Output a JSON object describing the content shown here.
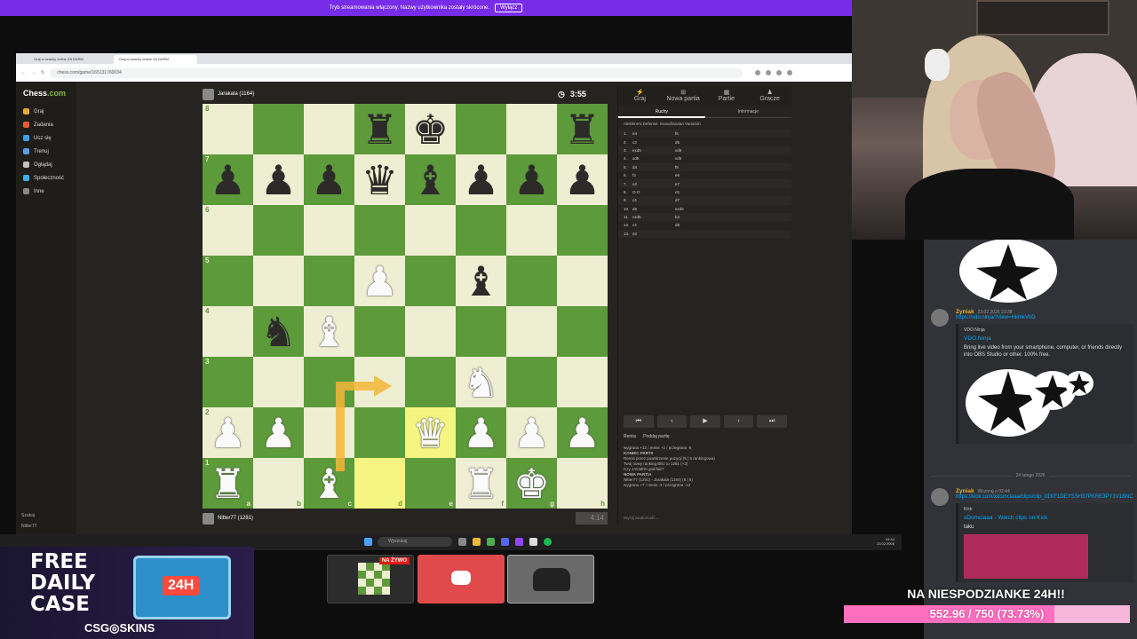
{
  "banner": {
    "text": "Tryb streamowania włączony. Nazwy użytkownika zostały skrócone.",
    "button": "Wyłącz"
  },
  "browser": {
    "tabs": [
      "Graj w szachy online ZA DARM",
      "Graj w szachy online ZA DARM"
    ],
    "url": "chess.com/game/165131760034"
  },
  "sidebar": {
    "logo_a": "Chess",
    "logo_b": ".com",
    "items": [
      "Graj",
      "Zadania",
      "Ucz się",
      "Trenuj",
      "Oglądaj",
      "Społeczność",
      "Inne"
    ],
    "bottom": [
      "Szukaj",
      "Nitter77"
    ]
  },
  "top_player": {
    "name": "Jarakala (1164)",
    "clock": "3:55"
  },
  "bottom_player": {
    "name": "Nitter77 (1281)",
    "clock": "4:14"
  },
  "board": {
    "ranks": [
      "8",
      "7",
      "6",
      "5",
      "4",
      "3",
      "2",
      "1"
    ],
    "files": [
      "a",
      "b",
      "c",
      "d",
      "e",
      "f",
      "g",
      "h"
    ],
    "rows": [
      [
        "",
        "",
        "",
        "bR",
        "bK",
        "",
        "",
        "bR"
      ],
      [
        "bP",
        "bP",
        "bP",
        "bQ",
        "bB",
        "bP",
        "bP",
        "bP"
      ],
      [
        "",
        "",
        "",
        "",
        "",
        "",
        "",
        ""
      ],
      [
        "",
        "",
        "",
        "wP",
        "",
        "bB",
        "",
        ""
      ],
      [
        "",
        "bN",
        "wB",
        "",
        "",
        "",
        "",
        ""
      ],
      [
        "",
        "",
        "",
        "",
        "",
        "wN",
        "",
        ""
      ],
      [
        "wP",
        "wP",
        "",
        "",
        "wQ",
        "wP",
        "wP",
        "wP"
      ],
      [
        "wR",
        "",
        "wB",
        "",
        "",
        "wR",
        "wK",
        ""
      ]
    ],
    "highlight": [
      "d1",
      "e2"
    ]
  },
  "panel": {
    "tabs": [
      "Graj",
      "Nowa partia",
      "Partie",
      "Gracze"
    ],
    "subtabs": [
      "Ruchy",
      "Informacje"
    ],
    "opening": "Alekhine's Defense: Scandinavian Variation",
    "moves": [
      [
        "1.",
        "e4",
        "f6"
      ],
      [
        "2.",
        "c3",
        "d5"
      ],
      [
        "3.",
        "exd5",
        "xd5"
      ],
      [
        "4.",
        "xd5",
        "xd5"
      ],
      [
        "5.",
        "d4",
        "f5"
      ],
      [
        "6.",
        "f3",
        "e6"
      ],
      [
        "7.",
        "e2",
        "e7"
      ],
      [
        "8.",
        "O-O",
        "c6"
      ],
      [
        "9.",
        "c4",
        "d7"
      ],
      [
        "10.",
        "d5",
        "exd5"
      ],
      [
        "11.",
        "cxd5",
        "b4"
      ],
      [
        "12.",
        "c4",
        "d8"
      ],
      [
        "13.",
        "e2",
        ""
      ]
    ],
    "nav": [
      "⏮",
      "‹",
      "▶",
      "›",
      "⏭"
    ],
    "actions": [
      "Remis",
      "Poddaj partię"
    ],
    "chat": [
      "wygrana +12 / remis +2 / przegrana -8",
      "KONIEC PARTII",
      "Remis przez powtórzenie pozycji (5 | 5 rankingowa)",
      "Twój nowy ranking Blitz to 1281 (+2)",
      "Czy JACMISI grał fair?",
      "NOWA PARTIA",
      "Nitter77 (1281) - Jarakala (1164) (5 | 5)",
      "wygrana +7 / remis -3 / przegrana -12"
    ],
    "chat_placeholder": "Wyślij wiadomość..."
  },
  "taskbar": {
    "search": "Wyszukaj",
    "time": "04:43",
    "date": "23.02.2026"
  },
  "discord": {
    "messages": [
      {
        "name": "Zyniak",
        "time": "23.02.2026 23:38",
        "link": "https://vdo.ninja/?view=HkmkVhD",
        "provider": "VDO.Ninja",
        "title": "VDO.Ninja",
        "desc": "Bring live video from your smartphone, computer, or friends directly into OBS Studio or other. 100% free."
      },
      {
        "name": "Zyniak",
        "time": "Wczoraj o 02:44",
        "link": "https://kick.com/xdomciaaa/clips/clip_01KF1DEYSSH37PKRE3PY1V1BNC",
        "provider": "Kick",
        "title": "xDomciaaa - Watch clips on Kick",
        "desc": "taku"
      }
    ],
    "date_separator": "24 lutego 2026"
  },
  "ad": {
    "line1": "FREE",
    "line2": "DAILY",
    "line3": "CASE",
    "crate": "24H",
    "brand": "CSG◎SKINS"
  },
  "live_badge": "NA ŻYWO",
  "goal": {
    "label": "NA NIESPODZIANKE 24H!!",
    "text": "552.96 / 750 (73.73%)",
    "fraction": 0.7373
  },
  "colors": {
    "light": "#eeeed2",
    "dark": "#5d9a3a",
    "highlight": "#f5f682",
    "goal": "#ff6fc0"
  }
}
